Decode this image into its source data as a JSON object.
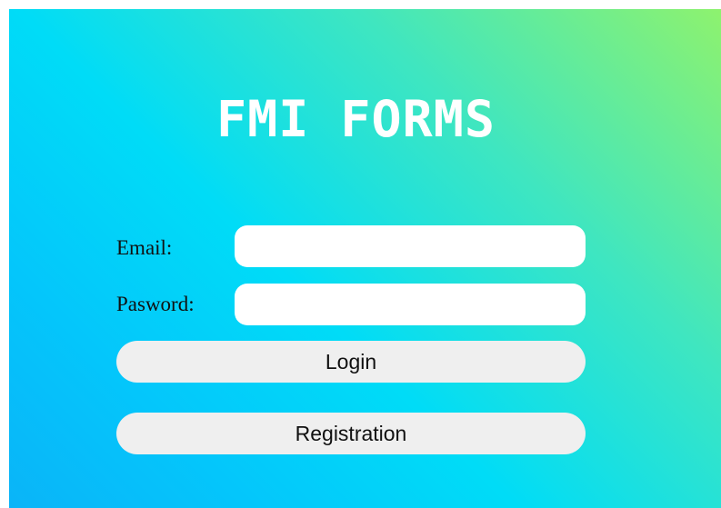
{
  "title": "FMI FORMS",
  "form": {
    "email_label": "Email:",
    "email_value": "",
    "password_label": "Pasword:",
    "password_value": "",
    "login_label": "Login",
    "registration_label": "Registration"
  },
  "colors": {
    "gradient_top_right": "#8ef26e",
    "gradient_middle": "#00dcf7",
    "gradient_bottom_left": "#0ab4f8",
    "button_bg": "#efefef",
    "title_color": "#ffffff"
  }
}
